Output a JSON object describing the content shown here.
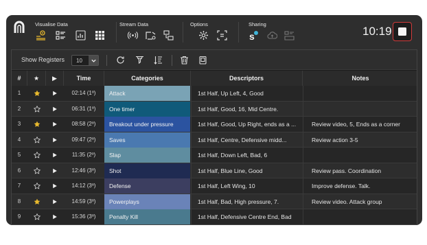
{
  "header": {
    "groups": [
      {
        "title": "Visualise Data",
        "icons": [
          "crosshair-person-icon",
          "list-toggle-icon",
          "bar-chart-icon",
          "grid-icon"
        ]
      },
      {
        "title": "Stream Data",
        "icons": [
          "broadcast-icon",
          "screen-cast-icon",
          "share-screens-icon"
        ]
      },
      {
        "title": "Options",
        "icons": [
          "settings-icon",
          "layout-icon"
        ]
      },
      {
        "title": "Sharing",
        "icons": [
          "sportscode-icon",
          "cloud-upload-icon",
          "media-icon"
        ]
      }
    ],
    "clock": "10:19"
  },
  "toolbar": {
    "show_label": "Show Registers",
    "select_value": "10"
  },
  "table": {
    "headers": {
      "num": "#",
      "star": "★",
      "play": "▶",
      "time": "Time",
      "categories": "Categories",
      "descriptors": "Descriptors",
      "notes": "Notes"
    },
    "rows": [
      {
        "num": "1",
        "starred": true,
        "time": "02:14 (1º)",
        "category": "Attack",
        "cat_color": "#7aa3b5",
        "descriptor": "1st Half, Up Left, 4, Good",
        "note": ""
      },
      {
        "num": "2",
        "starred": false,
        "time": "06:31 (1º)",
        "category": "One timer",
        "cat_color": "#105a7a",
        "descriptor": "1st Half, Good, 16, Mid Centre.",
        "note": ""
      },
      {
        "num": "3",
        "starred": true,
        "time": "08:58 (2º)",
        "category": "Breakout under pressure",
        "cat_color": "#2b53a0",
        "descriptor": "1st Half, Good, Up Right, ends as a ...",
        "note": "Review video, 5, Ends as a corner"
      },
      {
        "num": "4",
        "starred": false,
        "time": "09:47 (2º)",
        "category": "Saves",
        "cat_color": "#4a79b0",
        "descriptor": "1st Half, Centre, Defensive midd...",
        "note": "Review action 3-5"
      },
      {
        "num": "5",
        "starred": false,
        "time": "11:35 (2º)",
        "category": "Slap",
        "cat_color": "#5f8da0",
        "descriptor": "1st Half, Down Left, Bad, 6",
        "note": ""
      },
      {
        "num": "6",
        "starred": false,
        "time": "12:46 (3º)",
        "category": "Shot",
        "cat_color": "#1f2b52",
        "descriptor": "1st Half, Blue Line, Good",
        "note": "Review pass. Coordination"
      },
      {
        "num": "7",
        "starred": false,
        "time": "14:12 (3º)",
        "category": "Defense",
        "cat_color": "#3c3e60",
        "descriptor": "1st Half, Left Wing, 10",
        "note": "Improve defense. Talk."
      },
      {
        "num": "8",
        "starred": true,
        "time": "14:59 (3º)",
        "category": "Powerplays",
        "cat_color": "#6a83b8",
        "descriptor": "1st Half, Bad, High pressure, 7.",
        "note": "Review video. Attack group"
      },
      {
        "num": "9",
        "starred": false,
        "time": "15:36 (3º)",
        "category": "Penalty Kill",
        "cat_color": "#4a7a8e",
        "descriptor": "1st Half, Defensive Centre End, Bad",
        "note": ""
      }
    ]
  },
  "colors": {
    "accent": "#e8b92e",
    "alert": "#d33b3b",
    "sharing_badge": "#3fb4d8"
  }
}
